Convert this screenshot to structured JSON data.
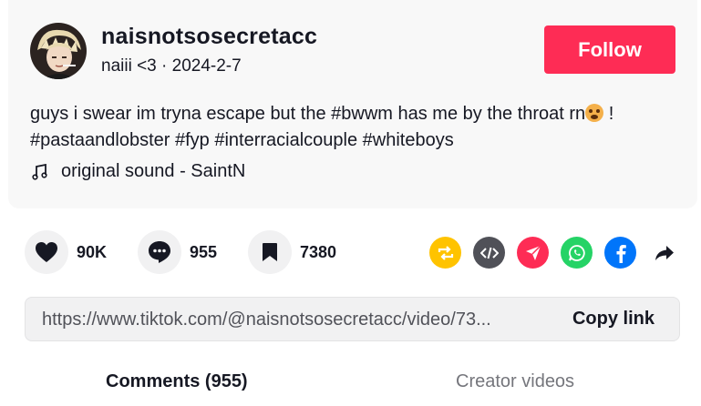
{
  "post": {
    "username": "naisnotsosecretacc",
    "display_name": "naiii <3",
    "separator": "·",
    "date": "2024-2-7",
    "follow_label": "Follow",
    "caption_text": "guys i swear im tryna escape but the #bwwm has me by the throat rn",
    "caption_after_emoji": " !",
    "hashtags_line": "#pastaandlobster #fyp #interracialcouple #whiteboys",
    "sound": "original sound - SaintN"
  },
  "actions": {
    "likes": "90K",
    "comments": "955",
    "saves": "7380"
  },
  "share_icons": [
    "repost-icon",
    "embed-icon",
    "send-icon",
    "whatsapp-icon",
    "facebook-icon",
    "share-arrow-icon"
  ],
  "link": {
    "url": "https://www.tiktok.com/@naisnotsosecretacc/video/73...",
    "copy_label": "Copy link"
  },
  "tabs": {
    "comments": "Comments (955)",
    "creator_videos": "Creator videos"
  },
  "colors": {
    "accent": "#fe2c55",
    "repost": "#ffc300",
    "embed": "#505158",
    "send": "#fe2c55",
    "whatsapp": "#25d366",
    "facebook": "#0075fa"
  }
}
